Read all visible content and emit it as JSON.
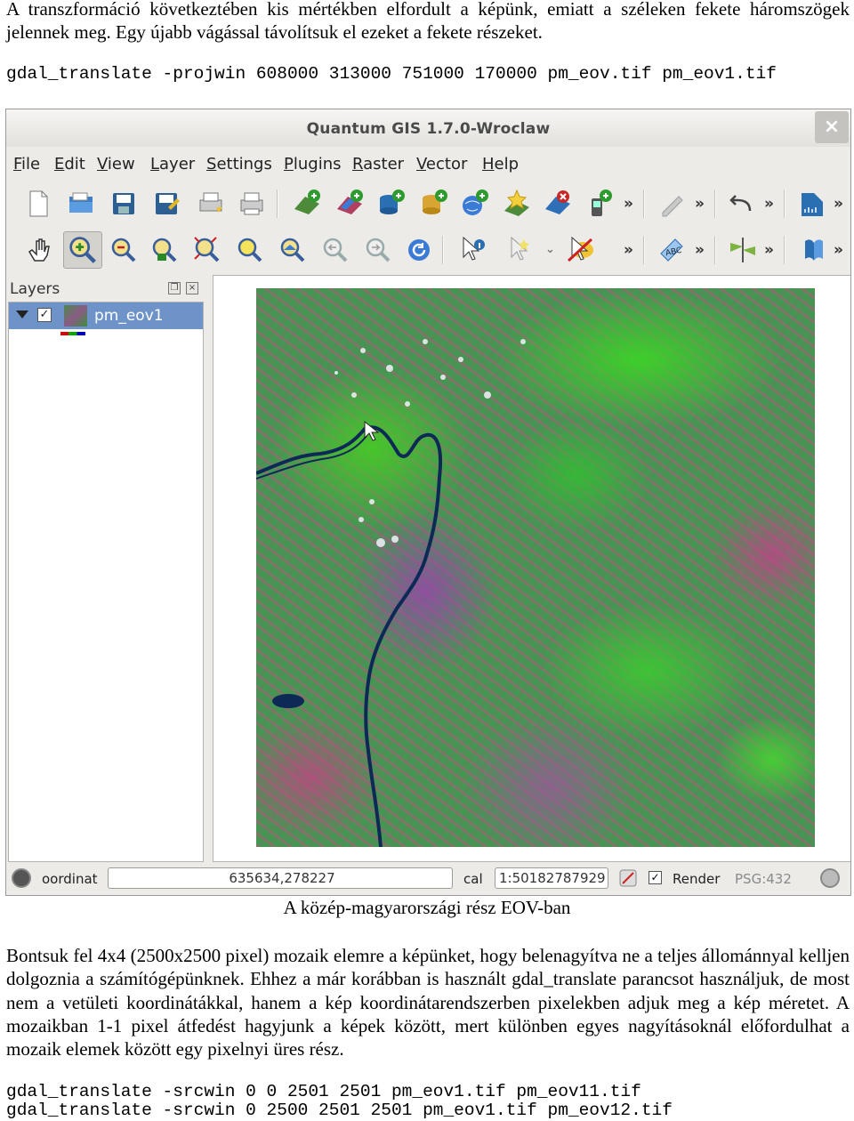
{
  "doc": {
    "para1": "A transzformáció következtében kis mértékben elfordult a képünk, emiatt a széleken fekete háromszögek jelennek meg. Egy újabb vágással távolítsuk el ezeket a fekete részeket.",
    "code1": "gdal_translate -projwin 608000 313000 751000 170000 pm_eov.tif pm_eov1.tif",
    "caption": "A közép-magyarországi rész EOV-ban",
    "para2": "Bontsuk fel 4x4 (2500x2500 pixel) mozaik elemre a képünket, hogy belenagyítva ne a teljes állománnyal kelljen dolgoznia a számítógépünknek. Ehhez a már korábban is használt gdal_translate parancsot használjuk, de most nem a vetületi koordinátákkal, hanem a kép koordinátarendszerben pixelekben adjuk meg a kép méretet. A mozaikban 1-1 pixel átfedést hagyjunk a képek között, mert különben egyes nagyításoknál előfordulhat a mozaik elemek között egy pixelnyi üres rész.",
    "code2": "gdal_translate -srcwin 0 0 2501 2501 pm_eov1.tif pm_eov11.tif",
    "code3": "gdal_translate -srcwin 0 2500 2501 2501 pm_eov1.tif pm_eov12.tif"
  },
  "window": {
    "title": "Quantum GIS 1.7.0-Wroclaw",
    "close_label": "×",
    "menus": [
      {
        "u": "F",
        "rest": "ile"
      },
      {
        "u": "E",
        "rest": "dit"
      },
      {
        "u": "V",
        "rest": "iew"
      },
      {
        "u": "L",
        "rest": "ayer"
      },
      {
        "u": "S",
        "rest": "ettings"
      },
      {
        "u": "P",
        "rest": "lugins"
      },
      {
        "u": "R",
        "rest": "aster"
      },
      {
        "u": "V",
        "rest": "ector"
      },
      {
        "u": "H",
        "rest": "elp"
      }
    ],
    "overflow_chevron": "»",
    "layers_panel": {
      "title": "Layers",
      "layer_name": "pm_eov1",
      "checked": "✓"
    },
    "statusbar": {
      "coord_label": "oordinat",
      "coord_value": "635634,278227",
      "scale_label": "cal",
      "scale_value": "1:50182787929",
      "render_label": "Render",
      "render_checked": "✓",
      "epsg": "PSG:432"
    },
    "colors": {
      "accent_selection": "#6d93c9",
      "river": "#0c2a55"
    }
  }
}
